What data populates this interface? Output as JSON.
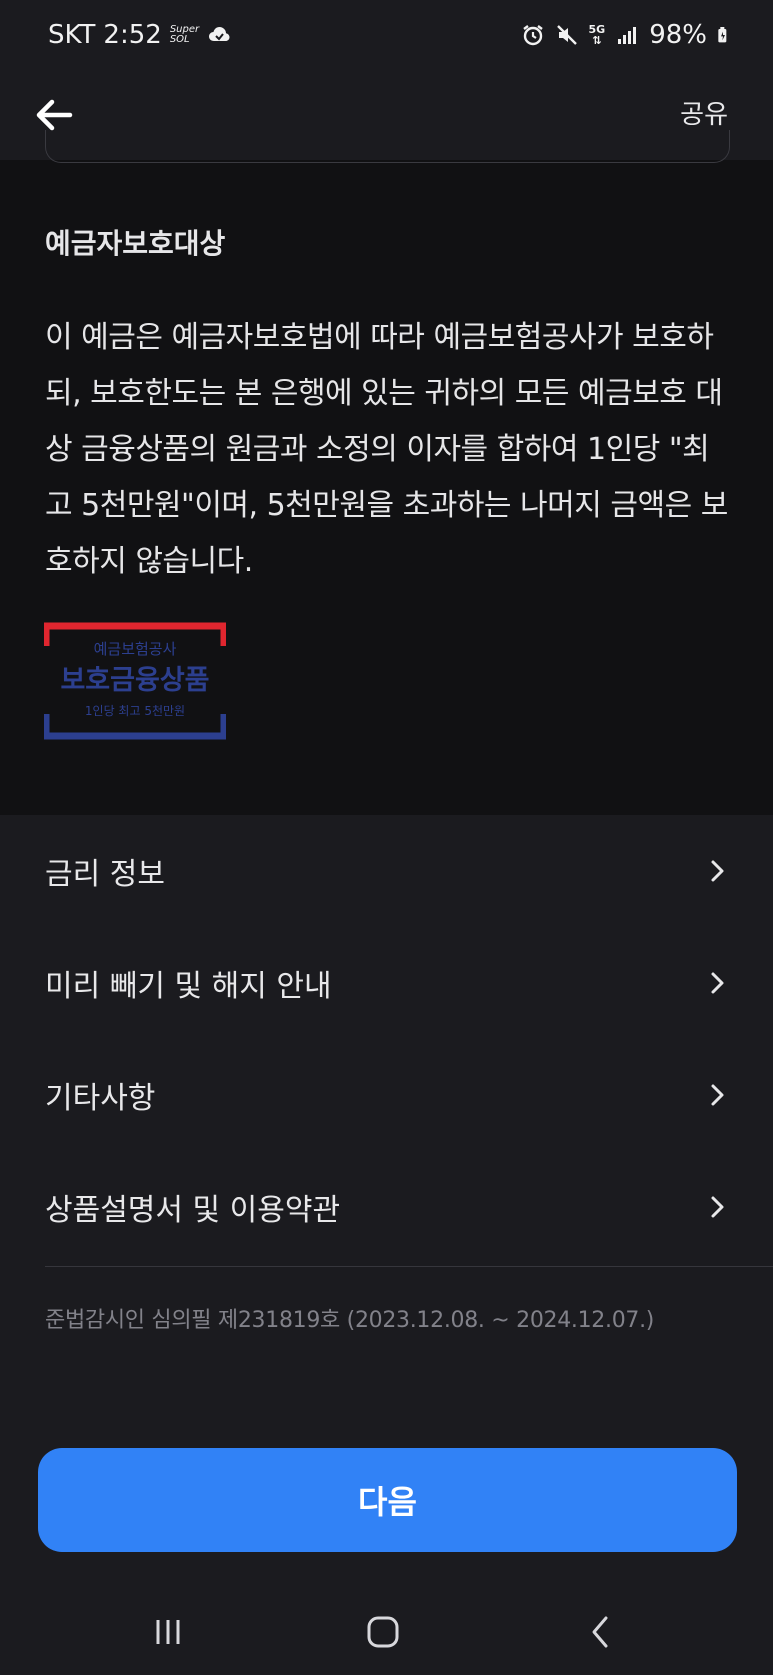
{
  "status_bar": {
    "carrier": "SKT",
    "time": "2:52",
    "super_label": "Super",
    "sol_label": "SOL",
    "network": "5G",
    "battery": "98%"
  },
  "app_bar": {
    "share_label": "공유"
  },
  "section": {
    "title": "예금자보호대상",
    "body": "이 예금은 예금자보호법에 따라 예금보험공사가 보호하되, 보호한도는 본 은행에 있는 귀하의 모든 예금보호 대상 금융상품의 원금과 소정의 이자를 합하여 1인당 \"최고 5천만원\"이며, 5천만원을 초과하는 나머지 금액은 보호하지 않습니다."
  },
  "logo": {
    "line1": "예금보험공사",
    "line2": "보호금융상품",
    "line3": "1인당 최고 5천만원",
    "color_red": "#e0262f",
    "color_blue": "#2c3f8f"
  },
  "menu": {
    "items": [
      {
        "label": "금리 정보"
      },
      {
        "label": "미리 빼기 및 해지 안내"
      },
      {
        "label": "기타사항"
      },
      {
        "label": "상품설명서 및 이용약관"
      }
    ]
  },
  "footnote": "준법감시인 심의필 제231819호 (2023.12.08. ~ 2024.12.07.)",
  "primary_button": {
    "label": "다음",
    "color": "#3182f6"
  },
  "nav": {
    "icons": [
      "recent-apps-icon",
      "home-icon",
      "back-icon"
    ]
  }
}
